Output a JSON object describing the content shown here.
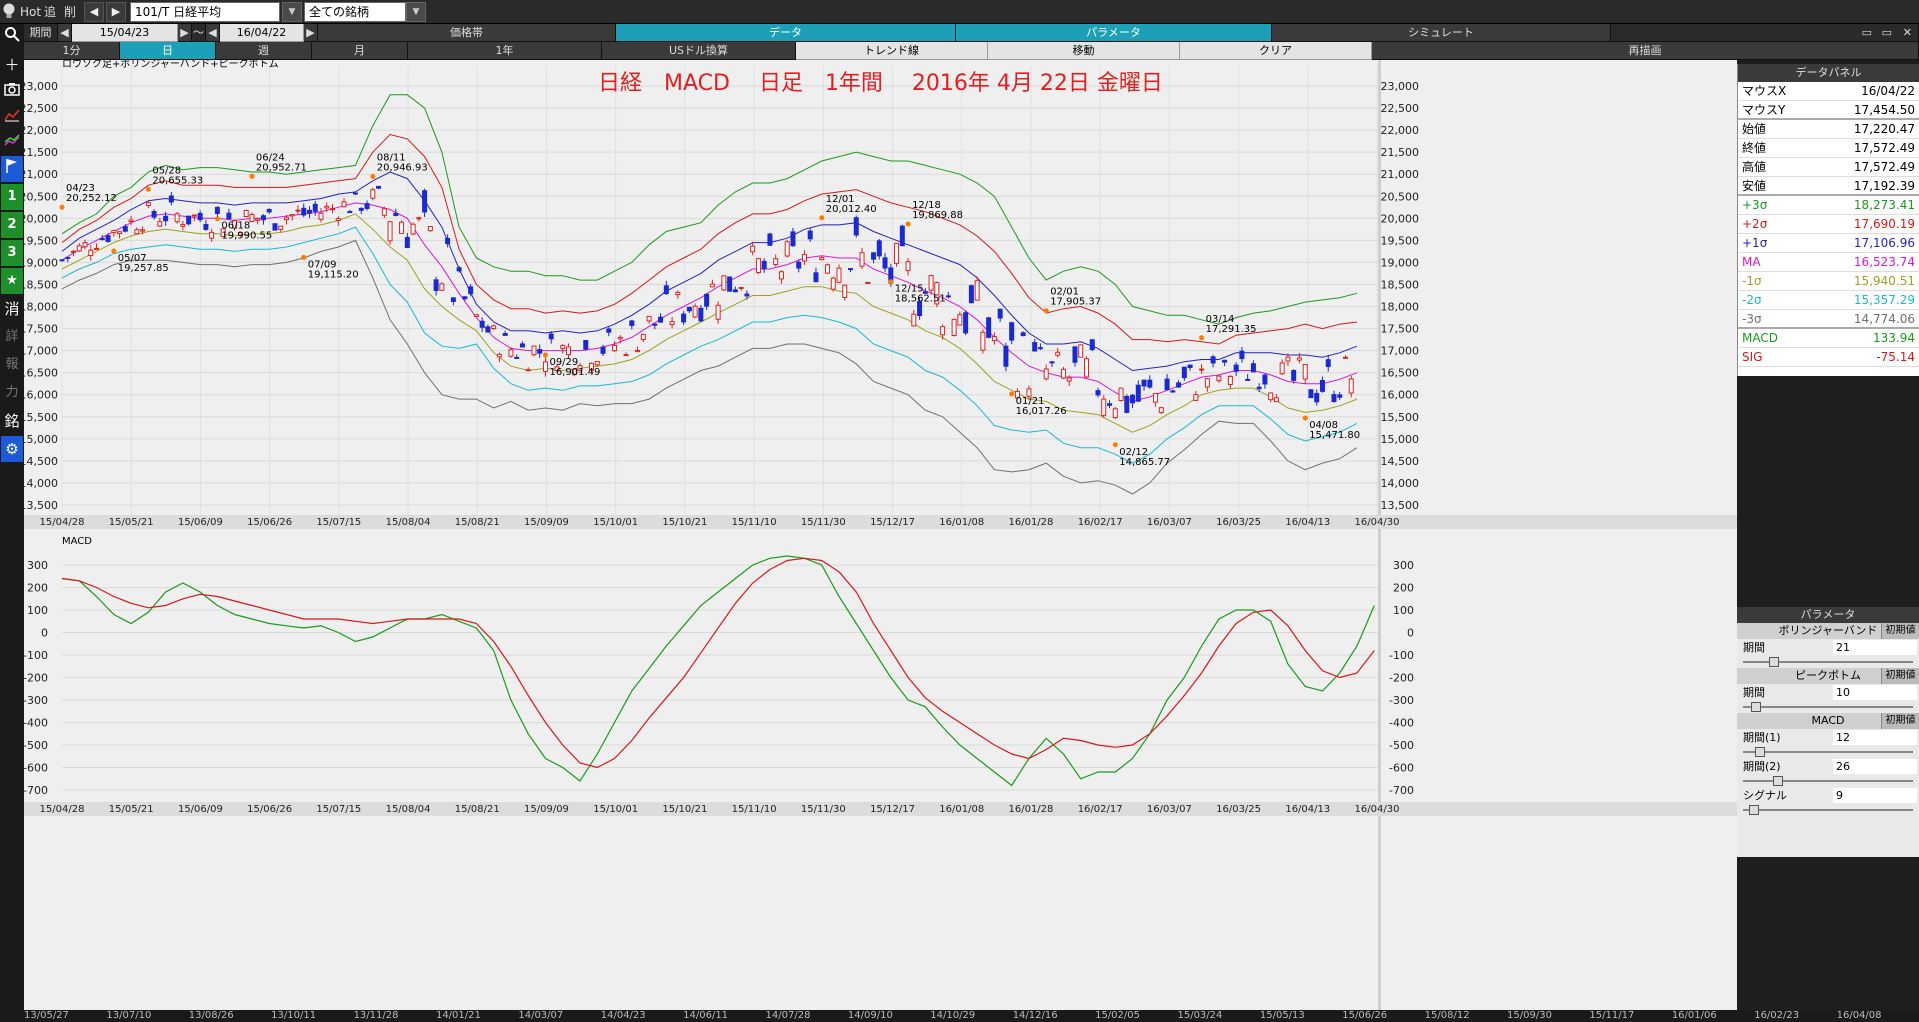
{
  "toolbar": {
    "hot": "Hot",
    "add": "追",
    "del": "削",
    "symbol": "101/T 日経平均",
    "universe": "全ての銘柄",
    "period_label": "期間",
    "date_from": "15/04/23",
    "tilde": "～",
    "date_to": "16/04/22"
  },
  "tabs_row1": [
    "価格帯",
    "データ",
    "パラメータ",
    "シミュレート"
  ],
  "tabs_row2": [
    "1分",
    "日",
    "週",
    "月",
    "1年",
    "USドル換算",
    "トレンド線",
    "移動",
    "クリア",
    "再描画"
  ],
  "leftbar": {
    "items": [
      "search-icon",
      "plus-icon",
      "camera-icon",
      "line-chart-icon",
      "multi-line-icon",
      "flag-icon",
      "1",
      "2",
      "3",
      "star-icon",
      "消",
      "詳",
      "報",
      "力",
      "銘",
      "gear-icon"
    ]
  },
  "chart": {
    "subtitle": "ロウソク足+ボリンジャーバンド+ピークボトム",
    "title": "日経　MACD　 日足　1年間　 2016年 4月 22日 金曜日",
    "price_ticks": [
      "23,000",
      "22,500",
      "22,000",
      "21,500",
      "21,000",
      "20,500",
      "20,000",
      "19,500",
      "19,000",
      "18,500",
      "18,000",
      "17,500",
      "17,000",
      "16,500",
      "16,000",
      "15,500",
      "15,000",
      "14,500",
      "14,000",
      "13,500"
    ],
    "date_ticks": [
      "15/04/28",
      "15/05/21",
      "15/06/09",
      "15/06/26",
      "15/07/15",
      "15/08/04",
      "15/08/21",
      "15/09/09",
      "15/10/01",
      "15/10/21",
      "15/11/10",
      "15/11/30",
      "15/12/17",
      "16/01/08",
      "16/01/28",
      "16/02/17",
      "16/03/07",
      "16/03/25",
      "16/04/13",
      "16/04/30"
    ],
    "macd_label": "MACD",
    "macd_ticks": [
      "300",
      "200",
      "100",
      "0",
      "-100",
      "-200",
      "-300",
      "-400",
      "-500",
      "-600",
      "-700"
    ],
    "bottom_dates": [
      "13/05/27",
      "13/07/10",
      "13/08/26",
      "13/10/11",
      "13/11/28",
      "14/01/21",
      "14/03/07",
      "14/04/23",
      "14/06/11",
      "14/07/28",
      "14/09/10",
      "14/10/29",
      "14/12/16",
      "15/02/05",
      "15/03/24",
      "15/05/13",
      "15/06/26",
      "15/08/12",
      "15/09/30",
      "15/11/17",
      "16/01/06",
      "16/02/23",
      "16/04/08"
    ],
    "peak_labels": [
      {
        "d": "04/23",
        "v": "20,252.12"
      },
      {
        "d": "05/07",
        "v": "19,257.85"
      },
      {
        "d": "05/28",
        "v": "20,655.33"
      },
      {
        "d": "06/18",
        "v": "19,990.55"
      },
      {
        "d": "06/24",
        "v": "20,952.71"
      },
      {
        "d": "07/09",
        "v": "19,115.20"
      },
      {
        "d": "08/11",
        "v": "20,946.93"
      },
      {
        "d": "09/29",
        "v": "16,901.49"
      },
      {
        "d": "12/01",
        "v": "20,012.40"
      },
      {
        "d": "12/15",
        "v": "18,562.51"
      },
      {
        "d": "12/18",
        "v": "19,869.88"
      },
      {
        "d": "01/21",
        "v": "16,017.26"
      },
      {
        "d": "02/01",
        "v": "17,905.37"
      },
      {
        "d": "02/12",
        "v": "14,865.77"
      },
      {
        "d": "03/14",
        "v": "17,291.35"
      },
      {
        "d": "04/08",
        "v": "15,471.80"
      }
    ]
  },
  "chart_data": {
    "type": "line",
    "series": [
      {
        "name": "+3σ",
        "color": "#1a9a1a",
        "values": [
          19650,
          19900,
          20100,
          20500,
          20700,
          21050,
          21200,
          21100,
          21150,
          21150,
          21100,
          21050,
          21050,
          21000,
          21050,
          21100,
          21150,
          21200,
          22100,
          22800,
          22800,
          22500,
          21500,
          19800,
          19100,
          18900,
          18800,
          18800,
          18700,
          18700,
          18600,
          18600,
          18800,
          19000,
          19400,
          19700,
          19800,
          19900,
          20300,
          20600,
          20800,
          20800,
          20900,
          21100,
          21300,
          21400,
          21500,
          21400,
          21300,
          21300,
          21200,
          21100,
          21000,
          20800,
          20500,
          19800,
          19100,
          18600,
          18800,
          18900,
          18800,
          18500,
          18000,
          17900,
          17800,
          17800,
          17700,
          17600,
          17750,
          17850,
          17900,
          18000,
          18100,
          18150,
          18200,
          18300
        ]
      },
      {
        "name": "+2σ",
        "color": "#d81818",
        "values": [
          19450,
          19750,
          19950,
          20250,
          20450,
          20750,
          20850,
          20750,
          20750,
          20750,
          20700,
          20700,
          20700,
          20700,
          20750,
          20800,
          20850,
          20900,
          21500,
          21900,
          21800,
          21400,
          20700,
          19300,
          18500,
          18150,
          17950,
          17950,
          17850,
          17900,
          17850,
          17900,
          18050,
          18300,
          18600,
          18900,
          19100,
          19300,
          19650,
          19900,
          20100,
          20100,
          20200,
          20400,
          20550,
          20600,
          20650,
          20500,
          20350,
          20250,
          20150,
          20000,
          19850,
          19600,
          19250,
          18750,
          18200,
          17850,
          17950,
          18000,
          17850,
          17600,
          17250,
          17250,
          17200,
          17250,
          17200,
          17150,
          17350,
          17400,
          17450,
          17500,
          17600,
          17500,
          17600,
          17650
        ]
      },
      {
        "name": "+1σ",
        "color": "#2222cc",
        "values": [
          19250,
          19550,
          19750,
          19950,
          20200,
          20400,
          20450,
          20400,
          20350,
          20350,
          20300,
          20350,
          20350,
          20350,
          20400,
          20450,
          20550,
          20600,
          20850,
          21050,
          20900,
          20400,
          19800,
          18850,
          18050,
          17650,
          17450,
          17450,
          17400,
          17450,
          17400,
          17450,
          17600,
          17800,
          18050,
          18350,
          18550,
          18750,
          19050,
          19250,
          19450,
          19450,
          19550,
          19750,
          19850,
          19850,
          19900,
          19700,
          19550,
          19400,
          19250,
          19100,
          18950,
          18650,
          18250,
          17800,
          17400,
          17150,
          17150,
          17200,
          17050,
          16800,
          16550,
          16600,
          16650,
          16750,
          16800,
          16800,
          16950,
          16950,
          16950,
          16900,
          16900,
          16850,
          16950,
          17100
        ]
      },
      {
        "name": "MA",
        "color": "#d818d8",
        "values": [
          19050,
          19300,
          19500,
          19700,
          19900,
          20050,
          20100,
          20050,
          20000,
          20000,
          19950,
          20000,
          20000,
          20050,
          20100,
          20150,
          20250,
          20350,
          20300,
          20200,
          20000,
          19400,
          18900,
          18300,
          17750,
          17300,
          17050,
          17000,
          17000,
          17000,
          17000,
          17050,
          17150,
          17300,
          17550,
          17800,
          18000,
          18200,
          18450,
          18650,
          18850,
          18850,
          18950,
          19100,
          19150,
          19100,
          19100,
          18850,
          18700,
          18550,
          18350,
          18200,
          18000,
          17700,
          17300,
          16950,
          16650,
          16500,
          16400,
          16400,
          16300,
          16050,
          15850,
          15950,
          16100,
          16250,
          16400,
          16450,
          16550,
          16550,
          16450,
          16300,
          16250,
          16250,
          16350,
          16500
        ]
      },
      {
        "name": "-1σ",
        "color": "#a0a020",
        "values": [
          18850,
          19050,
          19250,
          19450,
          19600,
          19700,
          19750,
          19700,
          19650,
          19650,
          19600,
          19650,
          19650,
          19700,
          19800,
          19850,
          19950,
          20100,
          19750,
          19350,
          19050,
          18400,
          18000,
          17700,
          17450,
          16950,
          16650,
          16550,
          16600,
          16550,
          16600,
          16650,
          16700,
          16800,
          17000,
          17250,
          17450,
          17650,
          17850,
          18050,
          18250,
          18250,
          18350,
          18450,
          18450,
          18350,
          18300,
          18000,
          17850,
          17700,
          17450,
          17300,
          17050,
          16700,
          16300,
          16100,
          15900,
          15850,
          15650,
          15600,
          15550,
          15350,
          15150,
          15300,
          15550,
          15750,
          16000,
          16100,
          16150,
          16150,
          15950,
          15700,
          15600,
          15650,
          15750,
          15900
        ]
      },
      {
        "name": "-2σ",
        "color": "#18b8d8",
        "values": [
          18650,
          18850,
          19000,
          19200,
          19300,
          19350,
          19400,
          19350,
          19300,
          19300,
          19250,
          19300,
          19300,
          19350,
          19450,
          19550,
          19650,
          19800,
          19200,
          18500,
          18100,
          17400,
          17100,
          17050,
          17150,
          16600,
          16250,
          16100,
          16150,
          16100,
          16200,
          16200,
          16250,
          16300,
          16450,
          16700,
          16900,
          17100,
          17250,
          17450,
          17650,
          17650,
          17750,
          17800,
          17750,
          17650,
          17500,
          17150,
          17000,
          16850,
          16550,
          16400,
          16100,
          15750,
          15300,
          15200,
          15150,
          15200,
          14900,
          14800,
          14800,
          14650,
          14450,
          14650,
          15000,
          15250,
          15550,
          15750,
          15750,
          15750,
          15450,
          15100,
          14950,
          15050,
          15150,
          15350
        ]
      },
      {
        "name": "-3σ",
        "color": "#707070",
        "values": [
          18400,
          18600,
          18750,
          18950,
          19050,
          19050,
          19050,
          19000,
          18950,
          18950,
          18900,
          18950,
          18950,
          19000,
          19100,
          19250,
          19350,
          19500,
          18650,
          17700,
          17150,
          16500,
          16000,
          15900,
          15900,
          15700,
          15850,
          15650,
          15700,
          15650,
          15800,
          15750,
          15800,
          15800,
          15900,
          16150,
          16350,
          16550,
          16650,
          16850,
          17050,
          17050,
          17150,
          17150,
          17050,
          16950,
          16700,
          16300,
          16150,
          16000,
          15650,
          15500,
          15150,
          14800,
          14300,
          14250,
          14300,
          14450,
          14150,
          14000,
          14050,
          13950,
          13750,
          14000,
          14450,
          14750,
          15100,
          15400,
          15350,
          15350,
          14950,
          14500,
          14300,
          14450,
          14550,
          14800
        ]
      },
      {
        "name": "MACD",
        "color": "#1a9a1a",
        "values": [
          240,
          230,
          160,
          80,
          40,
          90,
          180,
          220,
          180,
          120,
          80,
          60,
          40,
          30,
          20,
          30,
          0,
          -40,
          -20,
          20,
          60,
          60,
          80,
          50,
          20,
          -80,
          -300,
          -450,
          -560,
          -600,
          -660,
          -540,
          -400,
          -260,
          -160,
          -60,
          30,
          120,
          180,
          240,
          300,
          330,
          340,
          330,
          300,
          160,
          40,
          -80,
          -200,
          -300,
          -330,
          -420,
          -500,
          -560,
          -620,
          -680,
          -560,
          -470,
          -540,
          -650,
          -620,
          -620,
          -560,
          -450,
          -300,
          -200,
          -60,
          60,
          100,
          100,
          50,
          -140,
          -240,
          -260,
          -180,
          -60,
          120
        ]
      },
      {
        "name": "SIG",
        "color": "#d81818",
        "values": [
          240,
          230,
          200,
          160,
          130,
          110,
          120,
          150,
          170,
          160,
          140,
          120,
          100,
          80,
          60,
          60,
          60,
          50,
          40,
          50,
          60,
          60,
          60,
          60,
          40,
          -40,
          -150,
          -280,
          -400,
          -500,
          -580,
          -600,
          -560,
          -480,
          -380,
          -290,
          -200,
          -90,
          20,
          130,
          220,
          280,
          320,
          330,
          320,
          270,
          180,
          40,
          -80,
          -200,
          -290,
          -350,
          -400,
          -450,
          -500,
          -540,
          -560,
          -520,
          -470,
          -480,
          -500,
          -510,
          -500,
          -450,
          -370,
          -280,
          -180,
          -60,
          40,
          90,
          100,
          30,
          -80,
          -170,
          -200,
          -180,
          -80
        ]
      }
    ],
    "ylim_price": [
      13500,
      23000
    ],
    "ylim_macd": [
      -700,
      300
    ]
  },
  "data_panel": {
    "title": "データパネル",
    "rows": [
      {
        "k": "マウスX",
        "v": "16/04/22",
        "c": "#000"
      },
      {
        "k": "マウスY",
        "v": "17,454.50",
        "c": "#000"
      },
      {
        "k": "始値",
        "v": "17,220.47",
        "c": "#000"
      },
      {
        "k": "終値",
        "v": "17,572.49",
        "c": "#000"
      },
      {
        "k": "高値",
        "v": "17,572.49",
        "c": "#000"
      },
      {
        "k": "安値",
        "v": "17,192.39",
        "c": "#000"
      },
      {
        "k": "+3σ",
        "v": "18,273.41",
        "c": "#1a9a1a"
      },
      {
        "k": "+2σ",
        "v": "17,690.19",
        "c": "#d81818"
      },
      {
        "k": "+1σ",
        "v": "17,106.96",
        "c": "#2222cc"
      },
      {
        "k": "MA",
        "v": "16,523.74",
        "c": "#d818d8"
      },
      {
        "k": "-1σ",
        "v": "15,940.51",
        "c": "#a0a020"
      },
      {
        "k": "-2σ",
        "v": "15,357.29",
        "c": "#18b8d8"
      },
      {
        "k": "-3σ",
        "v": "14,774.06",
        "c": "#707070"
      },
      {
        "k": "MACD",
        "v": "133.94",
        "c": "#1a9a1a"
      },
      {
        "k": "SIG",
        "v": "-75.14",
        "c": "#d81818"
      }
    ]
  },
  "param_panel": {
    "title": "パラメータ",
    "reset": "初期値",
    "bollinger": "ボリンジャーバンド",
    "peakbottom": "ピークボトム",
    "macd": "MACD",
    "period": "期間",
    "period1": "期間(1)",
    "period2": "期間(2)",
    "signal": "シグナル",
    "v_boll": "21",
    "v_peak": "10",
    "v_p1": "12",
    "v_p2": "26",
    "v_sig": "9"
  }
}
